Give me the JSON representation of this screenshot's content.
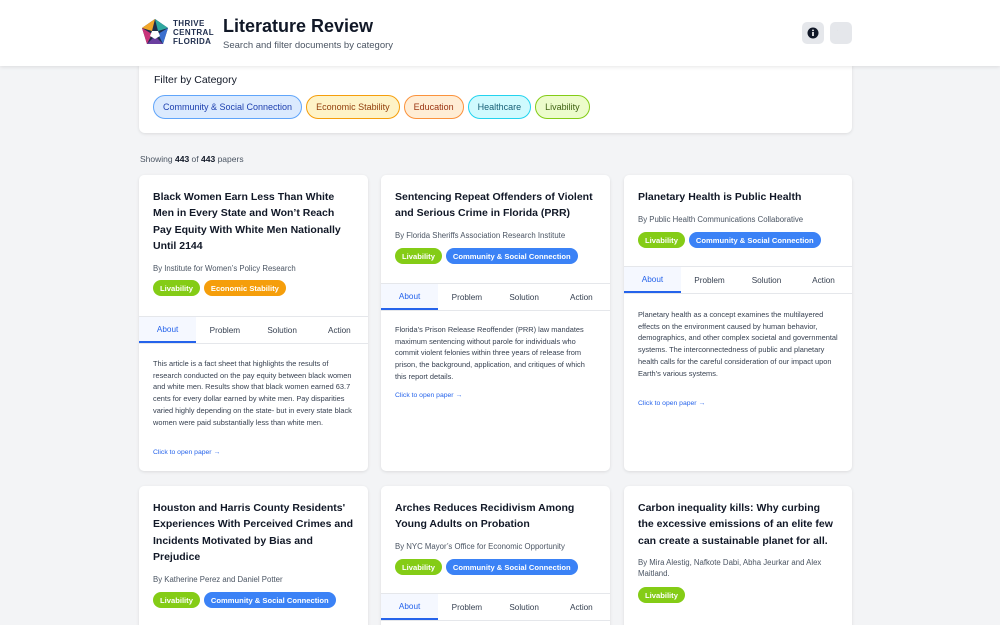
{
  "header": {
    "logo_lines": [
      "THRIVE",
      "CENTRAL",
      "FLORIDA"
    ],
    "title": "Literature Review",
    "subtitle": "Search and filter documents by category"
  },
  "filter": {
    "title": "Filter by Category",
    "categories": [
      "Community & Social Connection",
      "Economic Stability",
      "Education",
      "Healthcare",
      "Livability"
    ]
  },
  "results": {
    "prefix": "Showing",
    "shown": "443",
    "mid": "of",
    "total": "443",
    "suffix": "papers"
  },
  "tabs": [
    "About",
    "Problem",
    "Solution",
    "Action"
  ],
  "open_link": "Click to open paper →",
  "colors": {
    "accent": "#2563eb",
    "livability": "#84cc16",
    "economic": "#f59e0b",
    "community": "#3b82f6"
  },
  "papers": [
    {
      "title": "Black Women Earn Less Than White Men in Every State and Won’t Reach Pay Equity With White Men Nationally Until 2144",
      "author": "By Institute for Women’s Policy Research",
      "tags": [
        "Livability",
        "Economic Stability"
      ],
      "description": "This article is a fact sheet that highlights the results of research conducted on the pay equity between black women and white men. Results show that black women earned 63.7 cents for every dollar earned by white men. Pay disparities varied highly depending on the state- but in every state black women were paid substantially less than white men."
    },
    {
      "title": "Sentencing Repeat Offenders of Violent and Serious Crime in Florida (PRR)",
      "author": "By Florida Sheriffs Association Research Institute",
      "tags": [
        "Livability",
        "Community & Social Connection"
      ],
      "description": "Florida’s Prison Release Reoffender (PRR) law mandates maximum sentencing without parole for individuals who commit violent felonies within three years of release from prison, the background, application, and critiques of which this report details."
    },
    {
      "title": "Planetary Health is Public Health",
      "author": "By Public Health Communications Collaborative",
      "tags": [
        "Livability",
        "Community & Social Connection"
      ],
      "description": "Planetary health as a concept examines the multilayered effects on the environment caused by human behavior, demographics, and other complex societal and governmental systems. The interconnectedness of public and planetary health calls for the careful consideration of our impact upon Earth’s various systems."
    },
    {
      "title": "Houston and Harris County Residents' Experiences With Perceived Crimes and Incidents Motivated by Bias and Prejudice",
      "author": "By Katherine Perez and Daniel Potter",
      "tags": [
        "Livability",
        "Community & Social Connection"
      ]
    },
    {
      "title": "Arches Reduces Recidivism Among Young Adults on Probation",
      "author": "By NYC Mayor’s Office for Economic Opportunity",
      "tags": [
        "Livability",
        "Community & Social Connection"
      ]
    },
    {
      "title": "Carbon inequality kills: Why curbing the excessive emissions of an elite few can create a sustainable planet for all.",
      "author": "By Mira Alestig, Nafkote Dabi, Abha Jeurkar and Alex Maitland.",
      "tags": [
        "Livability"
      ]
    }
  ]
}
